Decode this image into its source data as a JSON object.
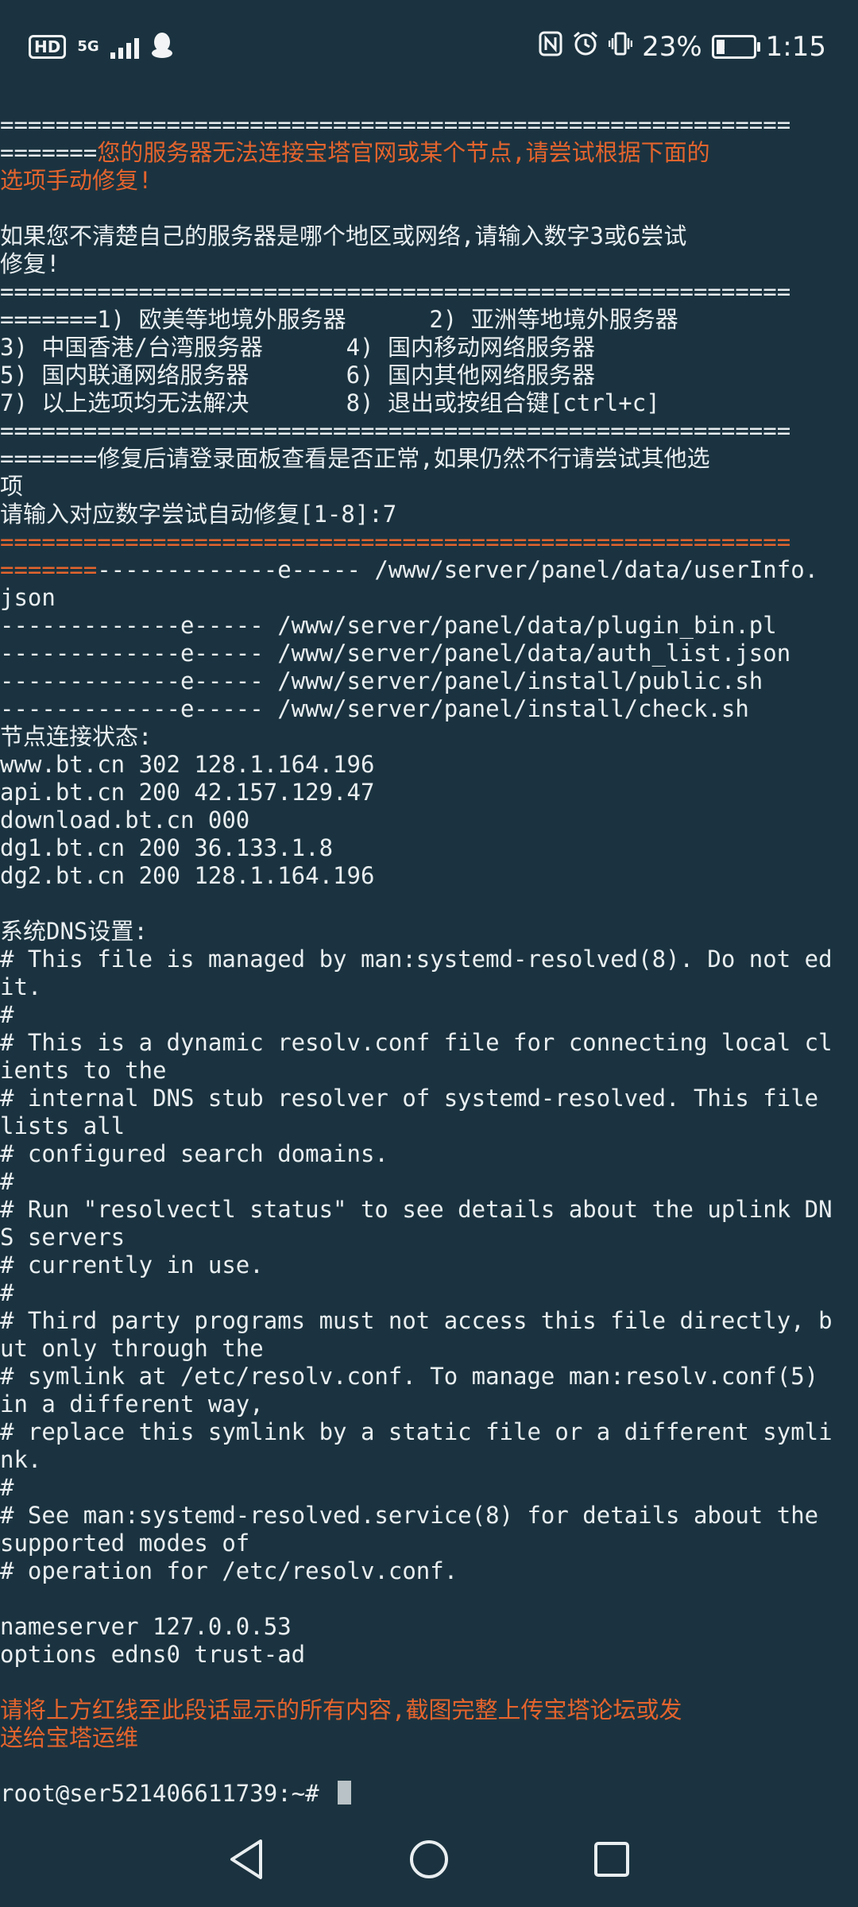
{
  "status_bar": {
    "hd": "HD",
    "network": "5G",
    "battery_percent": "23%",
    "battery_level": 0.23,
    "time": "1:15",
    "icons": [
      "qq-icon",
      "nfc-icon",
      "alarm-icon",
      "vibrate-icon",
      "battery-charging-icon"
    ]
  },
  "terminal": {
    "lines": [
      {
        "text": "=========================================================",
        "color": "white"
      },
      {
        "segments": [
          {
            "text": "=======",
            "color": "white"
          },
          {
            "text": "您的服务器无法连接宝塔官网或某个节点,请尝试根据下面的",
            "color": "orange"
          }
        ]
      },
      {
        "text": "选项手动修复!",
        "color": "orange"
      },
      {
        "text": "",
        "color": "white"
      },
      {
        "text": "如果您不清楚自己的服务器是哪个地区或网络,请输入数字3或6尝试",
        "color": "white"
      },
      {
        "text": "修复!",
        "color": "white"
      },
      {
        "text": "=========================================================",
        "color": "white"
      },
      {
        "text": "=======1) 欧美等地境外服务器      2) 亚洲等地境外服务器",
        "color": "white"
      },
      {
        "text": "3) 中国香港/台湾服务器      4) 国内移动网络服务器",
        "color": "white"
      },
      {
        "text": "5) 国内联通网络服务器       6) 国内其他网络服务器",
        "color": "white"
      },
      {
        "text": "7) 以上选项均无法解决       8) 退出或按组合键[ctrl+c]",
        "color": "white"
      },
      {
        "text": "=========================================================",
        "color": "white"
      },
      {
        "text": "=======修复后请登录面板查看是否正常,如果仍然不行请尝试其他选",
        "color": "white"
      },
      {
        "text": "项",
        "color": "white"
      },
      {
        "text": "请输入对应数字尝试自动修复[1-8]:7",
        "color": "white"
      },
      {
        "text": "=========================================================",
        "color": "orange"
      },
      {
        "segments": [
          {
            "text": "=======",
            "color": "orange"
          },
          {
            "text": "-------------e----- /www/server/panel/data/userInfo.",
            "color": "white"
          }
        ]
      },
      {
        "text": "json",
        "color": "white"
      },
      {
        "text": "-------------e----- /www/server/panel/data/plugin_bin.pl",
        "color": "white"
      },
      {
        "text": "-------------e----- /www/server/panel/data/auth_list.json",
        "color": "white"
      },
      {
        "text": "-------------e----- /www/server/panel/install/public.sh",
        "color": "white"
      },
      {
        "text": "-------------e----- /www/server/panel/install/check.sh",
        "color": "white"
      },
      {
        "text": "节点连接状态:",
        "color": "white"
      },
      {
        "text": "www.bt.cn 302 128.1.164.196",
        "color": "white"
      },
      {
        "text": "api.bt.cn 200 42.157.129.47",
        "color": "white"
      },
      {
        "text": "download.bt.cn 000",
        "color": "white"
      },
      {
        "text": "dg1.bt.cn 200 36.133.1.8",
        "color": "white"
      },
      {
        "text": "dg2.bt.cn 200 128.1.164.196",
        "color": "white"
      },
      {
        "text": "",
        "color": "white"
      },
      {
        "text": "系统DNS设置:",
        "color": "white"
      },
      {
        "text": "# This file is managed by man:systemd-resolved(8). Do not ed",
        "color": "white"
      },
      {
        "text": "it.",
        "color": "white"
      },
      {
        "text": "#",
        "color": "white"
      },
      {
        "text": "# This is a dynamic resolv.conf file for connecting local cl",
        "color": "white"
      },
      {
        "text": "ients to the",
        "color": "white"
      },
      {
        "text": "# internal DNS stub resolver of systemd-resolved. This file ",
        "color": "white"
      },
      {
        "text": "lists all",
        "color": "white"
      },
      {
        "text": "# configured search domains.",
        "color": "white"
      },
      {
        "text": "#",
        "color": "white"
      },
      {
        "text": "# Run \"resolvectl status\" to see details about the uplink DN",
        "color": "white"
      },
      {
        "text": "S servers",
        "color": "white"
      },
      {
        "text": "# currently in use.",
        "color": "white"
      },
      {
        "text": "#",
        "color": "white"
      },
      {
        "text": "# Third party programs must not access this file directly, b",
        "color": "white"
      },
      {
        "text": "ut only through the",
        "color": "white"
      },
      {
        "text": "# symlink at /etc/resolv.conf. To manage man:resolv.conf(5) ",
        "color": "white"
      },
      {
        "text": "in a different way,",
        "color": "white"
      },
      {
        "text": "# replace this symlink by a static file or a different symli",
        "color": "white"
      },
      {
        "text": "nk.",
        "color": "white"
      },
      {
        "text": "#",
        "color": "white"
      },
      {
        "text": "# See man:systemd-resolved.service(8) for details about the ",
        "color": "white"
      },
      {
        "text": "supported modes of",
        "color": "white"
      },
      {
        "text": "# operation for /etc/resolv.conf.",
        "color": "white"
      },
      {
        "text": "",
        "color": "white"
      },
      {
        "text": "nameserver 127.0.0.53",
        "color": "white"
      },
      {
        "text": "options edns0 trust-ad",
        "color": "white"
      },
      {
        "text": "",
        "color": "white"
      },
      {
        "text": "请将上方红线至此段话显示的所有内容,截图完整上传宝塔论坛或发",
        "color": "orange"
      },
      {
        "text": "送给宝塔运维",
        "color": "orange"
      },
      {
        "text": "",
        "color": "white"
      }
    ],
    "prompt": "root@ser521406611739:~# "
  },
  "colors": {
    "background": "#1b3340",
    "text": "#e9eef0",
    "orange": "#e4642d"
  },
  "nav_bar": {
    "icons": [
      "back-icon",
      "home-icon",
      "recents-icon"
    ]
  }
}
